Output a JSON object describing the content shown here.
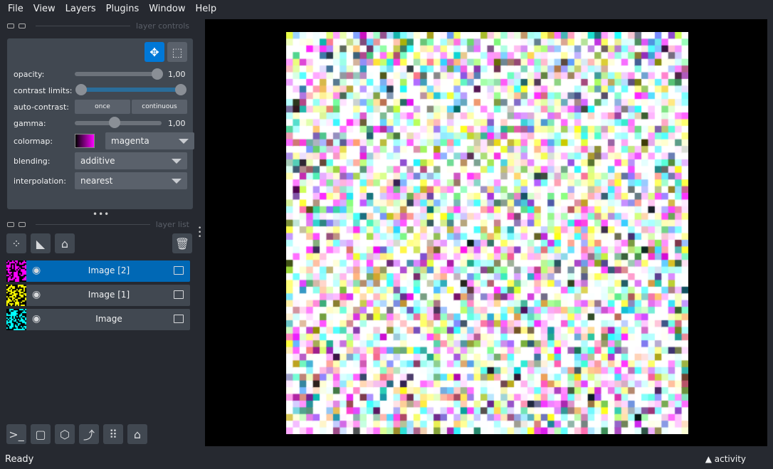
{
  "menu": [
    "File",
    "View",
    "Layers",
    "Plugins",
    "Window",
    "Help"
  ],
  "layer_controls": {
    "title": "layer controls",
    "opacity_label": "opacity:",
    "opacity_value": "1,00",
    "opacity": 1.0,
    "contrast_label": "contrast limits:",
    "autocontrast_label": "auto-contrast:",
    "once": "once",
    "continuous": "continuous",
    "gamma_label": "gamma:",
    "gamma_value": "1,00",
    "gamma": 1.0,
    "colormap_label": "colormap:",
    "colormap": "magenta",
    "blending_label": "blending:",
    "blending": "additive",
    "interpolation_label": "interpolation:",
    "interpolation": "nearest"
  },
  "layer_list": {
    "title": "layer list",
    "layers": [
      {
        "name": "Image [2]",
        "selected": true,
        "color": "#ff00ff"
      },
      {
        "name": "Image [1]",
        "selected": false,
        "color": "#ffff00"
      },
      {
        "name": "Image",
        "selected": false,
        "color": "#00ffff"
      }
    ]
  },
  "status": "Ready",
  "activity": "activity",
  "accent": "#0068b5"
}
